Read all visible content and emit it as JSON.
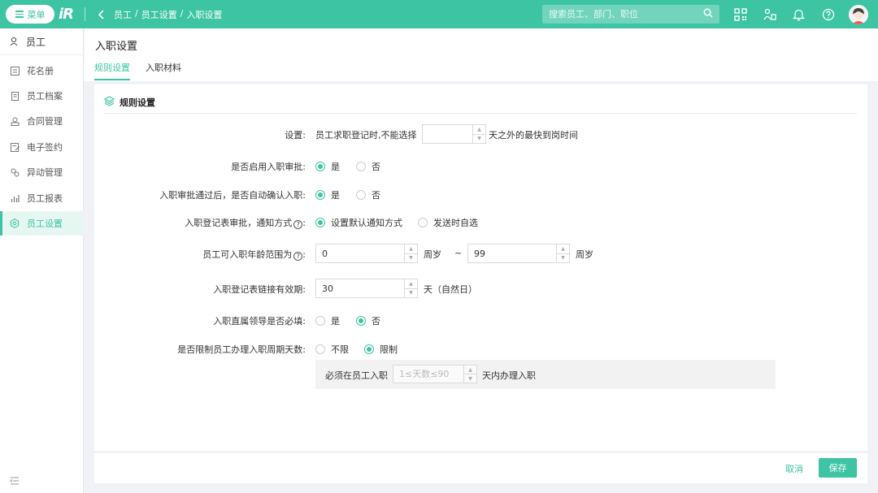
{
  "topbar": {
    "menu_label": "菜单",
    "logo_text": "iR",
    "breadcrumb": [
      "员工",
      "员工设置",
      "入职设置"
    ],
    "breadcrumb_sep": "/",
    "search_placeholder": "搜索员工、部门、职位",
    "accent_color": "#3cc4a3"
  },
  "sidebar": {
    "head": "员工",
    "items": [
      {
        "label": "花名册",
        "icon": "roster-icon"
      },
      {
        "label": "员工档案",
        "icon": "file-icon"
      },
      {
        "label": "合同管理",
        "icon": "contract-icon"
      },
      {
        "label": "电子签约",
        "icon": "esign-icon"
      },
      {
        "label": "异动管理",
        "icon": "transfer-icon"
      },
      {
        "label": "员工报表",
        "icon": "report-icon"
      },
      {
        "label": "员工设置",
        "icon": "settings-icon",
        "active": true
      }
    ]
  },
  "main": {
    "title": "入职设置",
    "tabs": [
      {
        "label": "规则设置",
        "active": true
      },
      {
        "label": "入职材料",
        "active": false
      }
    ]
  },
  "section": {
    "title": "规则设置"
  },
  "form": {
    "row1": {
      "label": "设置:",
      "prefix": "员工求职登记时,不能选择",
      "input_value": "",
      "suffix": "天之外的最快到岗时间"
    },
    "row2": {
      "label": "是否启用入职审批:",
      "options": [
        "是",
        "否"
      ],
      "selected": "是"
    },
    "row3": {
      "label": "入职审批通过后，是否自动确认入职:",
      "options": [
        "是",
        "否"
      ],
      "selected": "是"
    },
    "row4": {
      "label": "入职登记表审批，通知方式",
      "options": [
        "设置默认通知方式",
        "发送时自选"
      ],
      "selected": "设置默认通知方式"
    },
    "row5": {
      "label": "员工可入职年龄范围为",
      "min_value": "0",
      "min_unit": "周岁",
      "range_sep": "~",
      "max_value": "99",
      "max_unit": "周岁"
    },
    "row6": {
      "label": "入职登记表链接有效期:",
      "value": "30",
      "unit": "天（自然日）"
    },
    "row7": {
      "label": "入职直属领导是否必填:",
      "options": [
        "是",
        "否"
      ],
      "selected": "否"
    },
    "row8": {
      "label": "是否限制员工办理入职周期天数:",
      "options": [
        "不限",
        "限制"
      ],
      "selected": "限制",
      "sub_prefix": "必须在员工入职",
      "sub_placeholder": "1≤天数≤90",
      "sub_suffix": "天内办理入职"
    }
  },
  "footer": {
    "cancel_label": "取消",
    "save_label": "保存"
  }
}
